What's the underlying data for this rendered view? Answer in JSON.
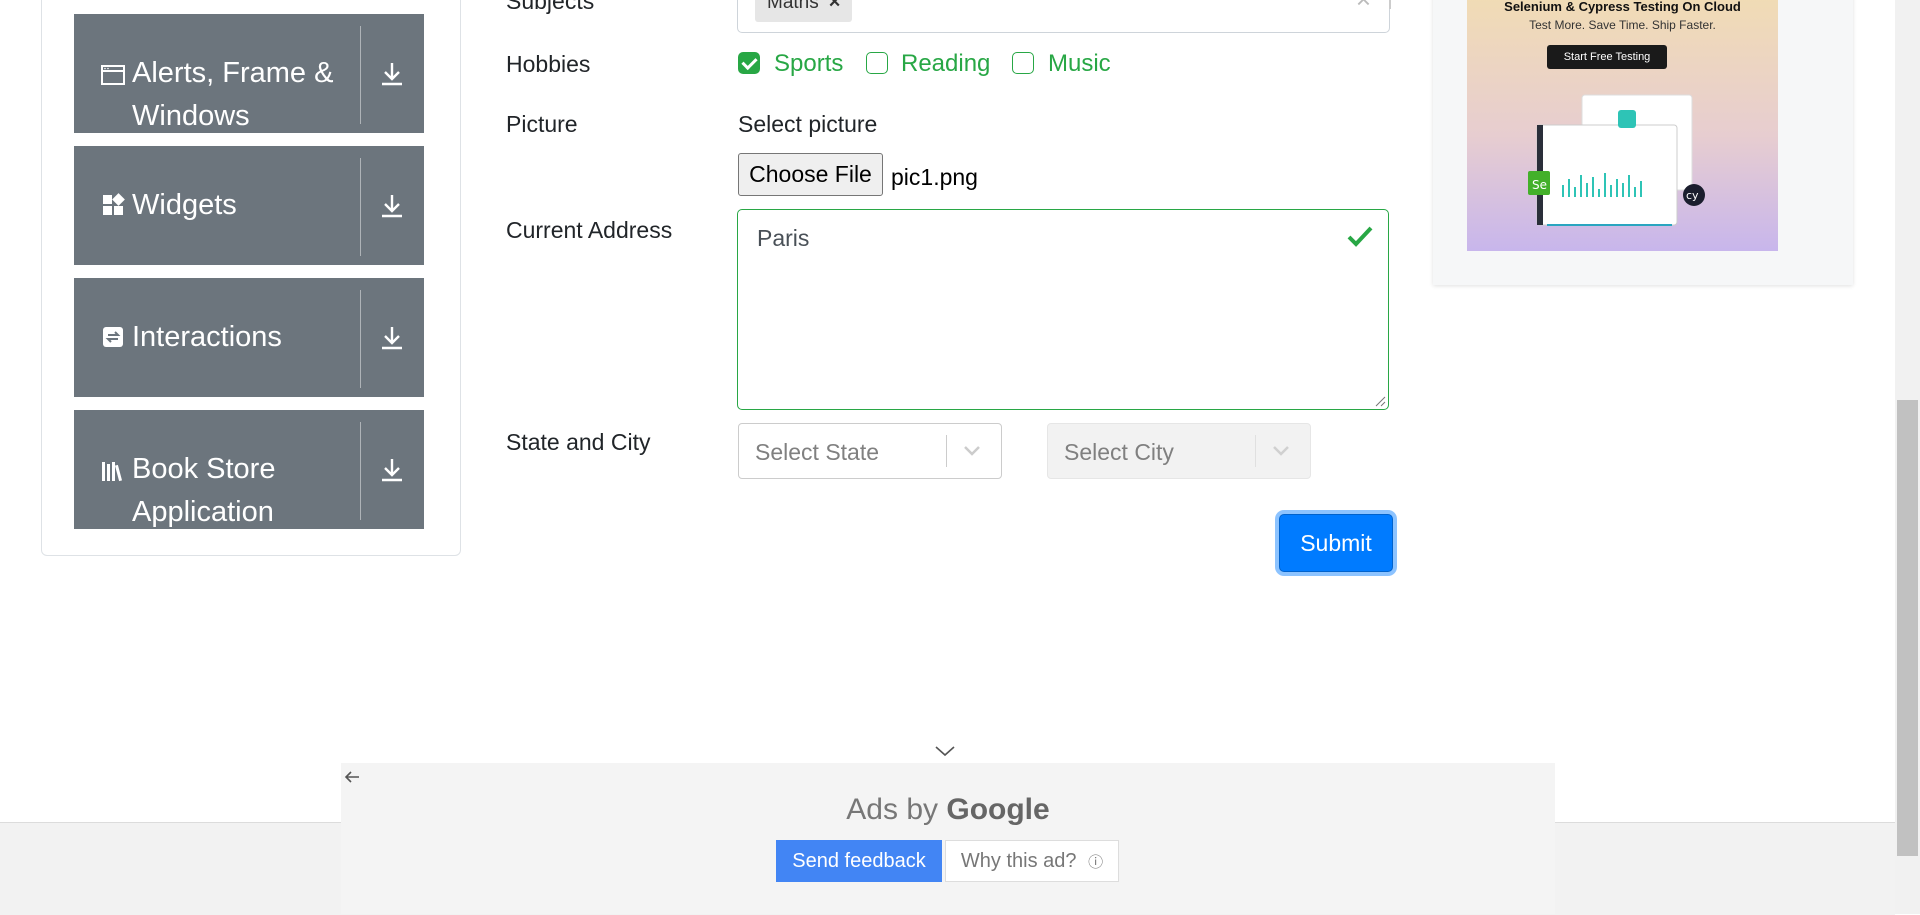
{
  "sidebar": {
    "groups": [
      {
        "label": "Alerts, Frame & Windows",
        "icon": "window-icon"
      },
      {
        "label": "Widgets",
        "icon": "widgets-icon"
      },
      {
        "label": "Interactions",
        "icon": "interactions-icon"
      },
      {
        "label": "Book Store Application",
        "icon": "books-icon"
      }
    ]
  },
  "form": {
    "subjects_label": "Subjects",
    "subject_chip": "Maths",
    "hobbies_label": "Hobbies",
    "hobbies": [
      {
        "label": "Sports",
        "checked": true
      },
      {
        "label": "Reading",
        "checked": false
      },
      {
        "label": "Music",
        "checked": false
      }
    ],
    "picture_label": "Picture",
    "select_picture_label": "Select picture",
    "choose_file_label": "Choose File",
    "file_name": "pic1.png",
    "address_label": "Current Address",
    "address_value": "Paris",
    "state_city_label": "State and City",
    "state_placeholder": "Select State",
    "city_placeholder": "Select City",
    "submit_label": "Submit"
  },
  "ad_right": {
    "title": "Selenium & Cypress Testing On Cloud",
    "subtitle": "Test More. Save Time. Ship Faster.",
    "cta": "Start Free Testing"
  },
  "google_ad": {
    "ads_by": "Ads by",
    "google": "Google",
    "send_feedback": "Send feedback",
    "why_this_ad": "Why this ad?"
  },
  "colors": {
    "accent": "#007bff",
    "success": "#28a745",
    "sidebar_bg": "#6c757d"
  }
}
